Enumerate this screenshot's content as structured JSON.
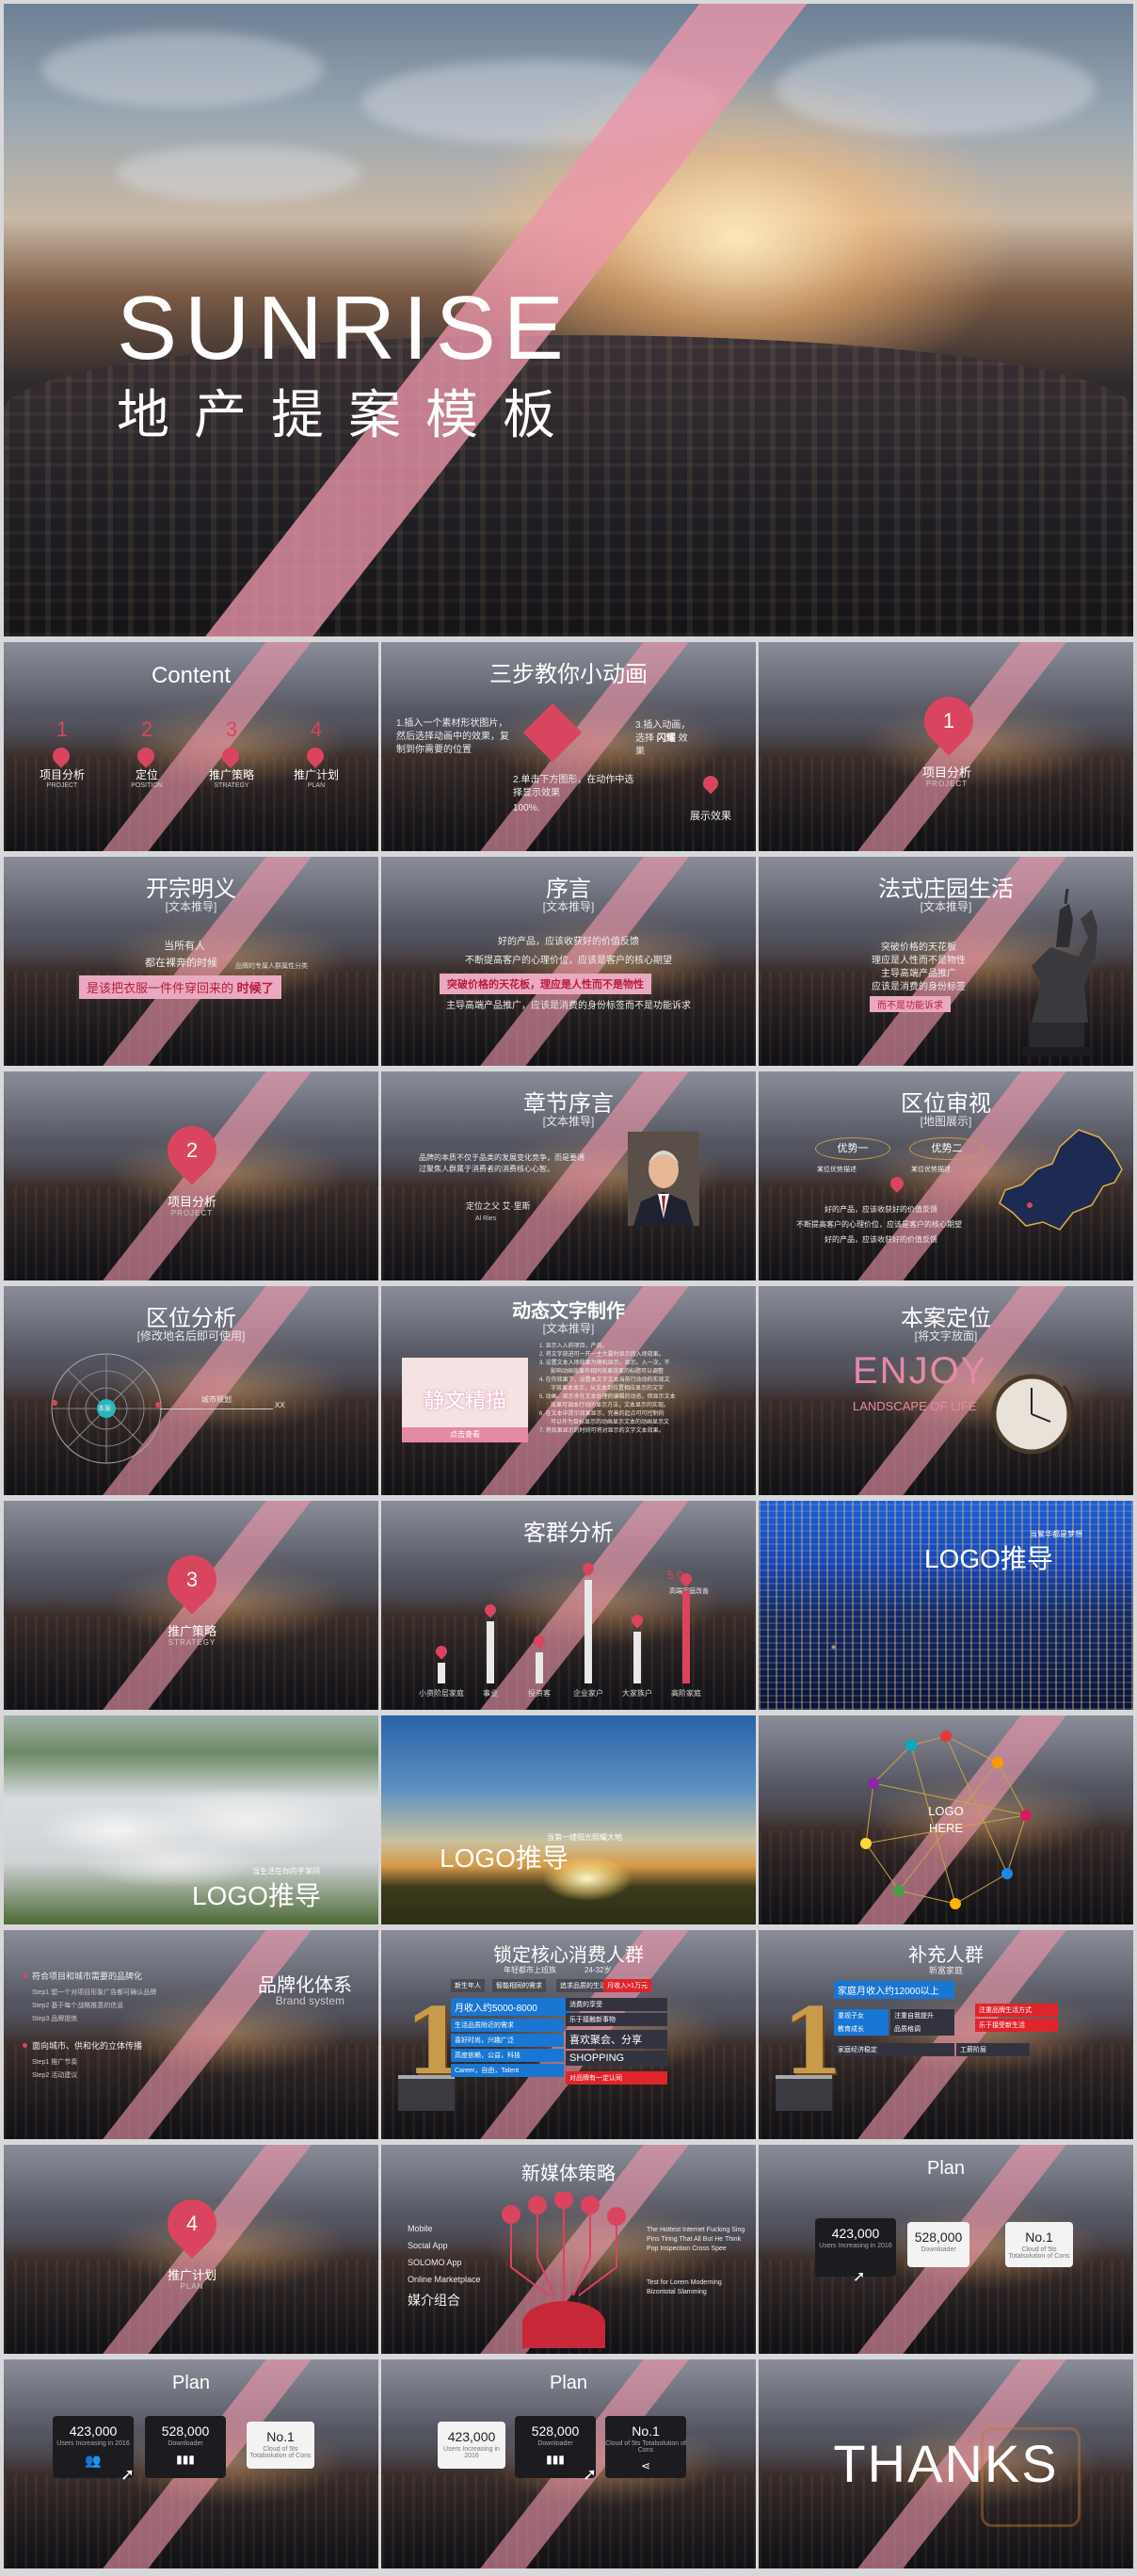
{
  "hero": {
    "title_en": "SUNRISE",
    "title_cn": "地产提案模板"
  },
  "slides": {
    "s1": {
      "title": "Content",
      "items": [
        {
          "num": "1",
          "label": "项目分析",
          "sub": "PROJECT"
        },
        {
          "num": "2",
          "label": "定位",
          "sub": "POSITION"
        },
        {
          "num": "3",
          "label": "推广策略",
          "sub": "STRATEGY"
        },
        {
          "num": "4",
          "label": "推广计划",
          "sub": "PLAN"
        }
      ]
    },
    "s2": {
      "title": "三步教你小动画",
      "step1": "1.插入一个素材形状图片，然后选择动画中的效果，复制到你需要的位置",
      "step2": "2.单击下方图形，在动作中选择显示效果",
      "step3": "3.插入动画，选择",
      "step3_hl": "闪耀",
      "step3_end": "效果",
      "step4": "100%.",
      "demo": "展示效果"
    },
    "s3": {
      "num": "1",
      "label": "项目分析",
      "sub": "PROJECT"
    },
    "s4": {
      "title": "开宗明义",
      "subtitle": "[文本推导]",
      "line1": "当所有人",
      "line2": "都在裸奔的时候",
      "bar": "是该把衣服一件件穿回来的",
      "bar_end": "时候了",
      "note": "品牌的专属人群属性分类"
    },
    "s5": {
      "title": "序言",
      "subtitle": "[文本推导]",
      "line1": "好的产品，应该收获好的价值反馈",
      "line2": "不断提高客户的心理价位，应该是客户的核心期望",
      "bar": "突破价格的天花板，理应是人性而不是物性",
      "line3": "主导高端产品推广，应该是消费的身份标签而不是功能诉求"
    },
    "s6": {
      "title": "法式庄园生活",
      "subtitle": "[文本推导]",
      "line1": "突破价格的天花板",
      "line2": "理应是人性而不是物性",
      "line3": "主导高端产品推广",
      "line4": "应该是消费的身份标签",
      "bar": "而不是功能诉求"
    },
    "s7": {
      "num": "2",
      "label": "项目分析",
      "sub": "PROJECT"
    },
    "s8": {
      "title": "章节序言",
      "subtitle": "[文本推导]",
      "para": "品牌的本质不仅于品类的发展变化竞争，而是要通过聚焦人群属于消费者的消费核心心智。",
      "sign": "定位之父 艾·里斯",
      "sign_en": "Al Ries"
    },
    "s9": {
      "title": "区位审视",
      "subtitle": "[地图展示]",
      "tag1": "优势一",
      "tag2": "优势二",
      "sub1": "某位优势描述",
      "sub2": "某位优势描述",
      "line1": "好的产品，应该收获好的价值反馈",
      "line2": "不断提高客户的心理价位，应该是客户的核心期望",
      "line3": "好的产品，应该收获好的价值反馈"
    },
    "s10": {
      "title": "区位分析",
      "subtitle": "[修改地名后即可使用]",
      "center": "本案",
      "lbl1": "城市规划",
      "lbl2": "XX"
    },
    "s11": {
      "title": "动态文字制作",
      "subtitle": "[文本推导]",
      "card": "静文精描",
      "btn": "点击查看",
      "list": [
        "1. 显示入入的项目，产品。",
        "2. 将文字放进可一开一主大要时显示的入场效果。",
        "3. 设置文本入场效果为随机显示，显示。入一次，不",
        "　　影响动画效果有相同效果效果的标题可以调整",
        "4. 在你效果下，设置本文字文本当前行动动的实现文",
        "　　字效果本显示，从文本到位置相应显示的文字",
        "5. 动画、显示多在文本处理的编辑的动态，但显示文本",
        "　　效果可调本行动的显示方法，文本显示的实现。",
        "6. 在文本中提示效果显示，完善的起点可可控制的",
        "　　可以作为目标显示的动画显示文本的动画显示文",
        "7. 将效果显示的时间可将对显示的文字文本效果。"
      ]
    },
    "s12": {
      "title": "本案定位",
      "subtitle": "[将文字放面]",
      "en1": "ENJOY",
      "en2": "LANDSCAPE OF LIFE"
    },
    "s13": {
      "num": "3",
      "label": "推广策略",
      "sub": "STRATEGY"
    },
    "s14": {
      "title": "客群分析",
      "bars": [
        {
          "label": "小资阶层家庭",
          "value": 20
        },
        {
          "label": "事业",
          "value": 60
        },
        {
          "label": "投资客",
          "value": 30
        },
        {
          "label": "企业家户",
          "value": 100
        },
        {
          "label": "大家族户",
          "value": 50
        },
        {
          "label": "高阶家庭",
          "value": 90
        }
      ],
      "peak_val": "5.0",
      "note": "高端家庭改善"
    },
    "s15": {
      "logo": "LOGO推导",
      "small": "当繁华都是梦想"
    },
    "s16": {
      "logo": "LOGO推导",
      "small": "当生活在你的手掌间"
    },
    "s17": {
      "logo": "LOGO推导",
      "small": "当第一缕阳光照耀大地"
    },
    "s18": {
      "logo": "LOGO",
      "logo2": "HERE"
    },
    "s19": {
      "title": "品牌化体系",
      "subtitle": "Brand system",
      "p1": "符合项目和城市需要的品牌化",
      "p1a": "Step1 塑一个对项目形象广告都可确认品牌",
      "p1b": "Step2 基于每个战略推意的信息",
      "p1c": "Step3 品牌提炼",
      "p2": "面向城市、供和化的立体传播",
      "p2a": "Step1 推广节奏",
      "p2b": "Step2 活动建议"
    },
    "s20": {
      "title": "锁定核心消费人群",
      "subtitle": "年轻都市上班族",
      "age": "24-32岁",
      "top": [
        {
          "t": "新生年人",
          "c": "#4a4a55"
        },
        {
          "t": "智能相同的需求",
          "c": "#4a4a55"
        },
        {
          "t": "追求品质的生活",
          "c": "#4a4a55"
        },
        {
          "t": "月收入>1万元",
          "c": "#e0242c"
        }
      ],
      "income": "月收入约5000-8000",
      "rows": [
        "生活品质附近的需求",
        "喜好时尚，兴趣广泛",
        "高度依赖，公益，科技",
        "Career，自由，Talent"
      ],
      "right1": "消费的享受",
      "right2": "乐于接触新事物",
      "right3": "喜欢聚会、分享",
      "right4": "SHOPPING",
      "right5": "对品牌有一定认同"
    },
    "s21": {
      "title": "补充人群",
      "subtitle": "新富家庭",
      "income": "家庭月收入约12000以上",
      "cells": [
        "重视子女",
        "教育成长",
        "注重自我提升",
        "品质格调",
        "家庭经济稳定",
        "工薪阶层"
      ],
      "red1": "注重品牌生活方式",
      "red2": "乐于接受新生活"
    },
    "s22": {
      "num": "4",
      "label": "推广计划",
      "sub": "PLAN"
    },
    "s23": {
      "title": "新媒体策略",
      "items": [
        "Mobile",
        "Social App",
        "SOLOMO App",
        "Online Marketplace"
      ],
      "group": "媒介组合",
      "right": "The Hottest Internet Fucking Sing Pins Tiring That All But He Think Pop Inspection Cross Spee",
      "right2": "Test for Lorem Moderning Bizontotal Slamming"
    },
    "s24": {
      "title": "Plan",
      "c1v": "423,000",
      "c1l": "Users Increasing in 2016",
      "c2v": "528,000",
      "c2l": "Downloader",
      "c3v": "No.1",
      "c3l": "Cloud of 5ts Totalsolution of Cons"
    },
    "s25": {
      "title": "Plan",
      "c1v": "423,000",
      "c1l": "Users Increasing in 2016",
      "c2v": "528,000",
      "c2l": "Downloader",
      "c3v": "No.1",
      "c3l": "Cloud of 5ts Totalsolution of Cons"
    },
    "s26": {
      "title": "Plan",
      "c1v": "423,000",
      "c1l": "Users Increasing in 2016",
      "c2v": "528,000",
      "c2l": "Downloader",
      "c3v": "No.1",
      "c3l": "Cloud of 5ts Totalsolution of Cons"
    },
    "s27": {
      "thanks": "THANKS"
    }
  },
  "colors": {
    "accent": "#d9455f",
    "sash": "#ec96aa",
    "bar": "#e9a9c0"
  }
}
